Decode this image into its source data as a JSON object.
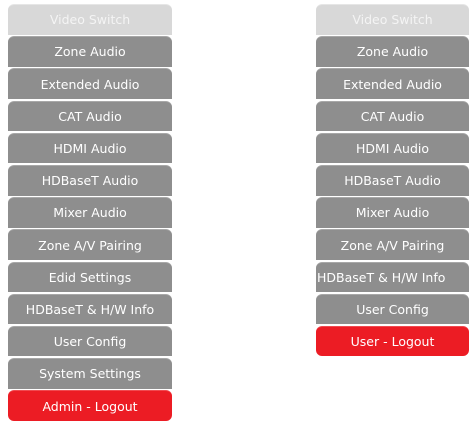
{
  "left_menu": {
    "items": [
      {
        "label": "Video Switch"
      },
      {
        "label": "Zone Audio"
      },
      {
        "label": "Extended Audio"
      },
      {
        "label": "CAT Audio"
      },
      {
        "label": "HDMI Audio"
      },
      {
        "label": "HDBaseT Audio"
      },
      {
        "label": "Mixer Audio"
      },
      {
        "label": "Zone A/V Pairing"
      },
      {
        "label": "Edid Settings"
      },
      {
        "label": "HDBaseT & H/W Info"
      },
      {
        "label": "User Config"
      },
      {
        "label": "System Settings"
      },
      {
        "label": "Admin - Logout"
      }
    ]
  },
  "right_menu": {
    "items": [
      {
        "label": "Video Switch"
      },
      {
        "label": "Zone Audio"
      },
      {
        "label": "Extended Audio"
      },
      {
        "label": "CAT Audio"
      },
      {
        "label": "HDMI Audio"
      },
      {
        "label": "HDBaseT Audio"
      },
      {
        "label": "Mixer Audio"
      },
      {
        "label": "Zone A/V Pairing"
      },
      {
        "label": "HDBaseT & H/W Info"
      },
      {
        "label": "User Config"
      },
      {
        "label": "User - Logout"
      }
    ]
  },
  "colors": {
    "active_bg": "#d8d8d8",
    "item_bg": "#8e8e8e",
    "logout_bg": "#ec1c24",
    "text": "#ffffff"
  }
}
